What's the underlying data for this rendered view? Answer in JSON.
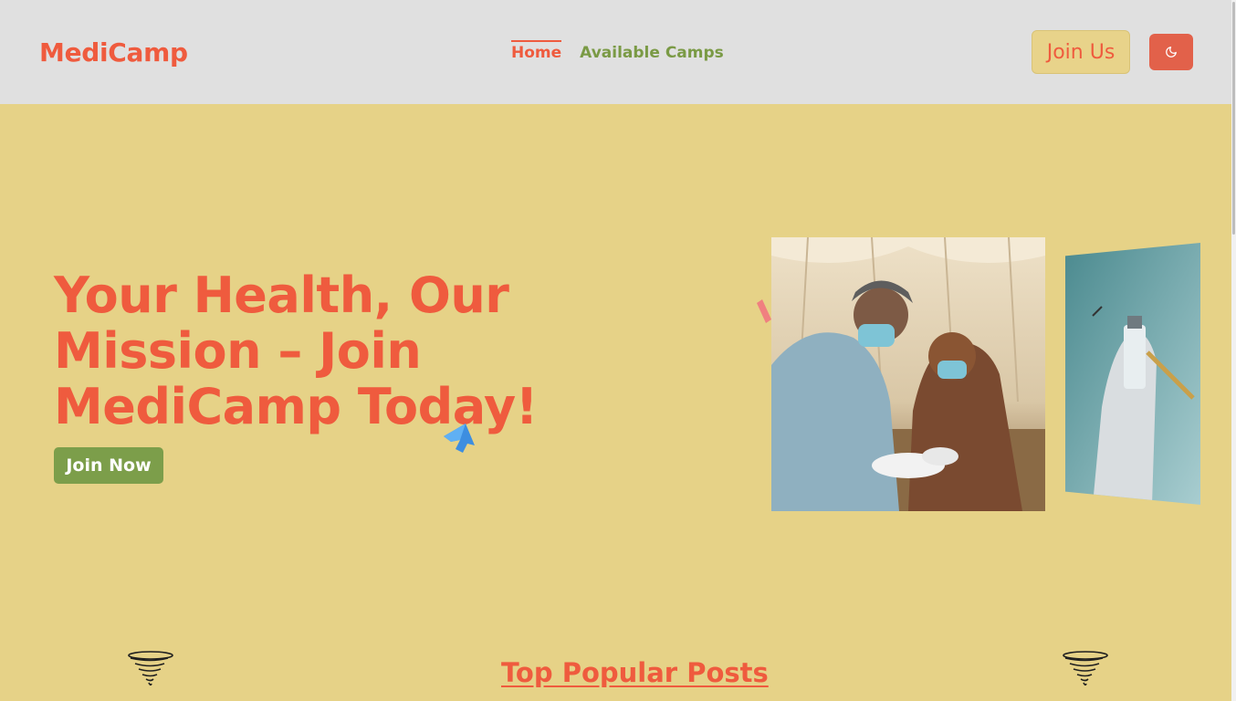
{
  "navbar": {
    "logo": "MediCamp",
    "links": [
      {
        "label": "Home",
        "active": true
      },
      {
        "label": "Available Camps",
        "active": false
      }
    ],
    "join_label": "Join Us",
    "theme_icon": "moon-icon"
  },
  "hero": {
    "title": "Your Health, Our Mission – Join MediCamp Today!",
    "cta_label": "Join Now",
    "main_image": "medical-camp-photo",
    "side_image": "vaccine-syringe-photo"
  },
  "section": {
    "title": "Top Popular Posts",
    "decoration_icon": "tornado-icon"
  },
  "colors": {
    "brand": "#ef5b3e",
    "green": "#7c9e4a",
    "background": "#e6d287",
    "navbar": "#e0e0e0"
  }
}
